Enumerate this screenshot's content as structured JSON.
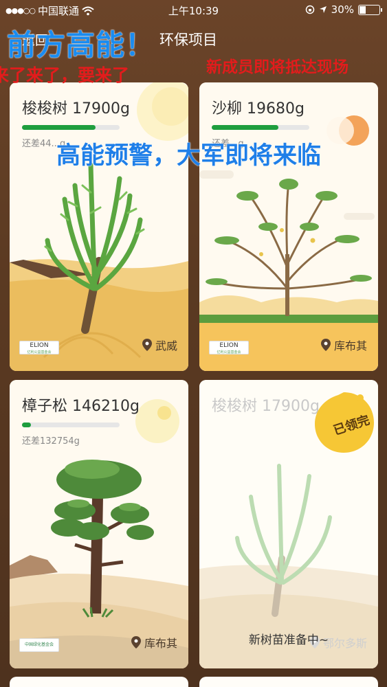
{
  "status_bar": {
    "signal": "●●●○○",
    "carrier": "中国联通",
    "wifi_icon": "wifi-icon",
    "time": "上午10:39",
    "battery": "30%",
    "battery_level": 0.3
  },
  "nav": {
    "back_label": "返回",
    "title": "环保项目"
  },
  "danmaku": [
    {
      "text": "前方高能！",
      "color": "#1a8cf0"
    },
    {
      "text": "来了来了，要来了",
      "color": "#e21c1c"
    },
    {
      "text": "新成员即将抵达现场",
      "color": "#e21c1c"
    },
    {
      "text": "高能预警，大军即将来临",
      "color": "#1f7fe8"
    }
  ],
  "cards": [
    {
      "name": "梭梭树 17900g",
      "remain": "还差44...g",
      "progress": 0.75,
      "location": "武威",
      "logo": "ELION",
      "logo_sub": "亿利公益基金会"
    },
    {
      "name": "沙柳 19680g",
      "remain": "还差...g",
      "progress": 0.68,
      "location": "库布其",
      "logo": "ELION",
      "logo_sub": "亿利公益基金会"
    },
    {
      "name": "樟子松 146210g",
      "remain": "还差132754g",
      "progress": 0.09,
      "location": "库布其",
      "logo": "中国绿化基金会"
    },
    {
      "name": "梭梭树 17900g",
      "location": "鄂尔多斯",
      "stamp": "已领完",
      "status": "新树苗准备中~"
    }
  ]
}
